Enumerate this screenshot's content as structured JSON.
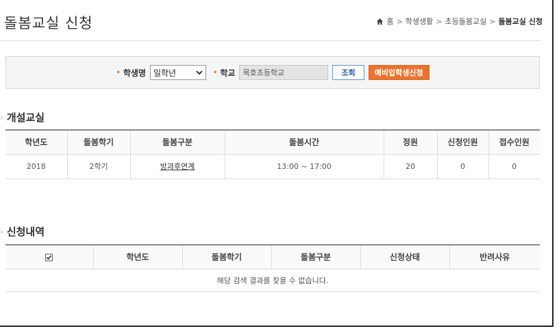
{
  "header": {
    "title": "돌봄교실 신청",
    "breadcrumb": [
      "홈",
      "학생생활",
      "초등돌봄교실",
      "돌봄교실 신청"
    ]
  },
  "search": {
    "student_label": "학생명",
    "student_value": "일학년",
    "school_label": "학교",
    "school_value": "목호초등학교",
    "search_button": "조회",
    "apply_button": "예비입학생신청"
  },
  "open_class": {
    "title": "개설교실",
    "columns": [
      "학년도",
      "돌봄학기",
      "돌봄구분",
      "돌봄시간",
      "정원",
      "신청인원",
      "접수인원"
    ],
    "rows": [
      [
        "2018",
        "2학기",
        "방과후연계",
        "13:00 ~ 17:00",
        "20",
        "0",
        "0"
      ]
    ]
  },
  "applications": {
    "title": "신청내역",
    "columns": [
      "학년도",
      "돌봄학기",
      "돌봄구분",
      "신청상태",
      "반려사유"
    ],
    "empty_message": "해당 검색 결과를 찾을 수 없습니다."
  },
  "colors": {
    "accent": "#e8742f",
    "search_button_text": "#2a5ea8"
  }
}
